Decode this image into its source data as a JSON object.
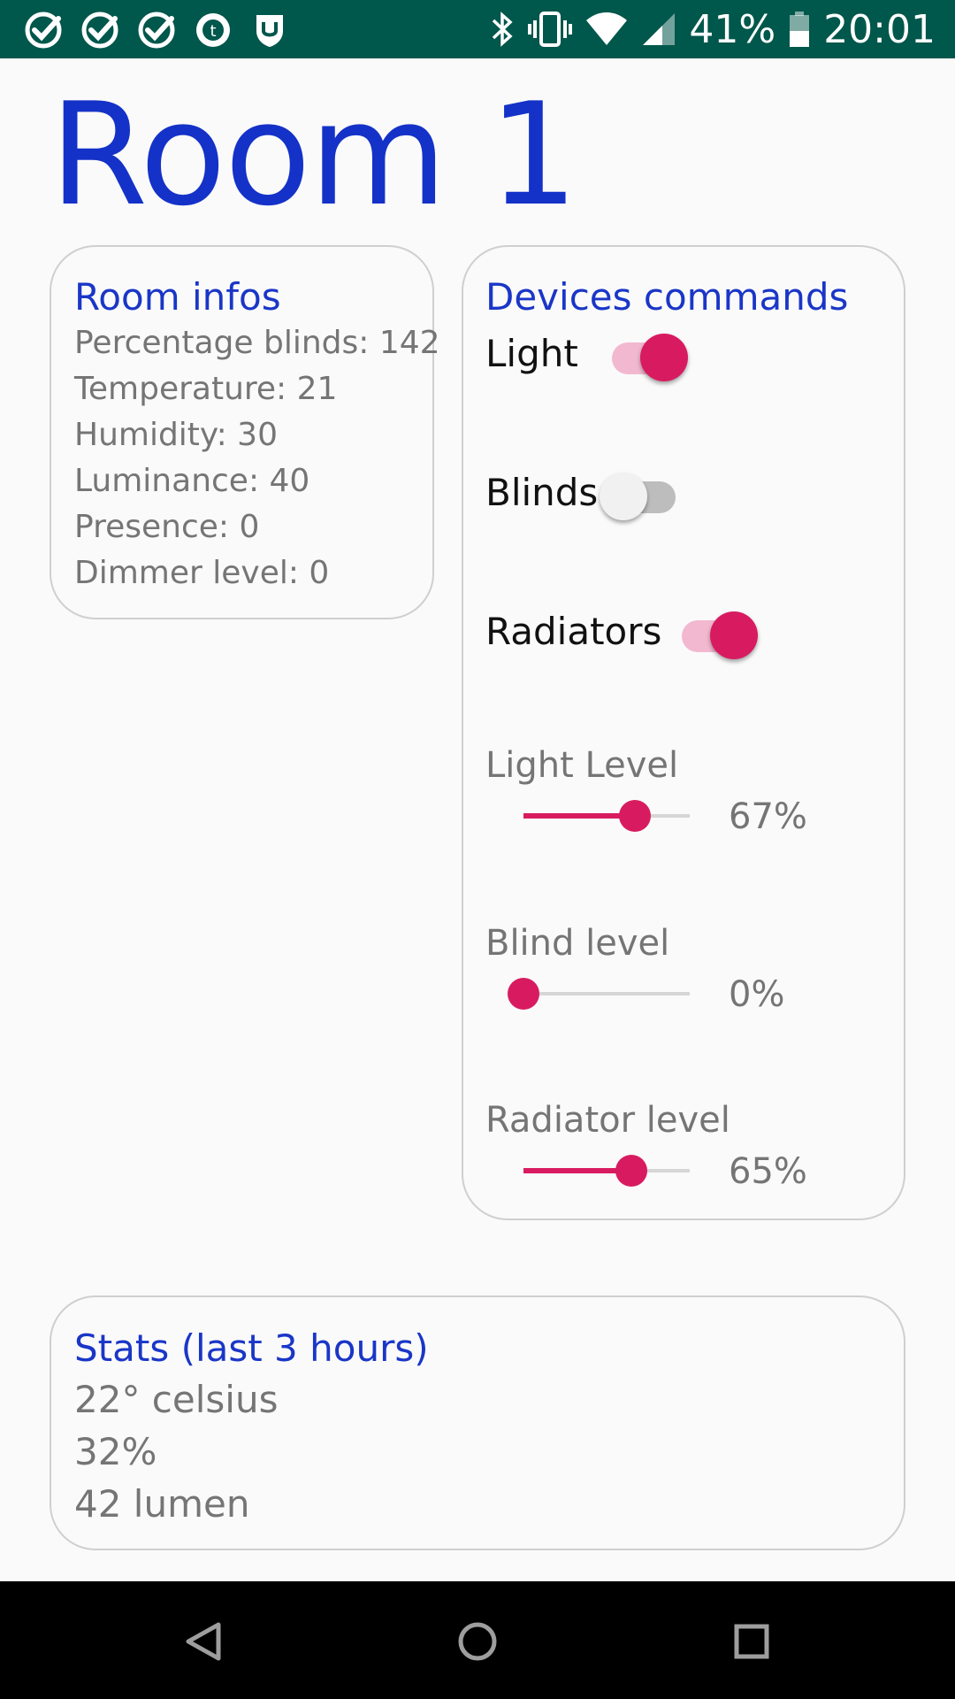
{
  "status_bar": {
    "battery": "41%",
    "time": "20:01",
    "left_icons": [
      "check-circle-icon",
      "check-circle-icon",
      "check-circle-icon",
      "tumblr-notification-icon",
      "shield-notification-icon"
    ],
    "right_icons": [
      "bluetooth-icon",
      "vibrate-icon",
      "wifi-icon",
      "signal-icon",
      "battery-icon"
    ]
  },
  "page": {
    "title": "Room 1"
  },
  "room_infos": {
    "heading": "Room infos",
    "lines": [
      "Percentage blinds: 142",
      "Temperature: 21",
      "Humidity: 30",
      "Luminance: 40",
      "Presence: 0",
      "Dimmer level: 0"
    ]
  },
  "devices": {
    "heading": "Devices commands",
    "switches": [
      {
        "label": "Light",
        "on": true
      },
      {
        "label": "Blinds",
        "on": false
      },
      {
        "label": "Radiators",
        "on": true
      }
    ],
    "sliders": [
      {
        "label": "Light Level",
        "value_text": "67%",
        "fraction": 0.67
      },
      {
        "label": "Blind level",
        "value_text": "0%",
        "fraction": 0.0
      },
      {
        "label": "Radiator level",
        "value_text": "65%",
        "fraction": 0.65
      }
    ]
  },
  "stats": {
    "heading": "Stats (last 3 hours)",
    "lines": [
      "22° celsius",
      "32%",
      "42 lumen"
    ]
  },
  "colors": {
    "status_bar": "#00574b",
    "title_blue": "#1432c8",
    "accent": "#d81b60",
    "accent_light": "#f2b8cf"
  },
  "nav": {
    "buttons": [
      "back-icon",
      "home-icon",
      "recents-icon"
    ]
  }
}
